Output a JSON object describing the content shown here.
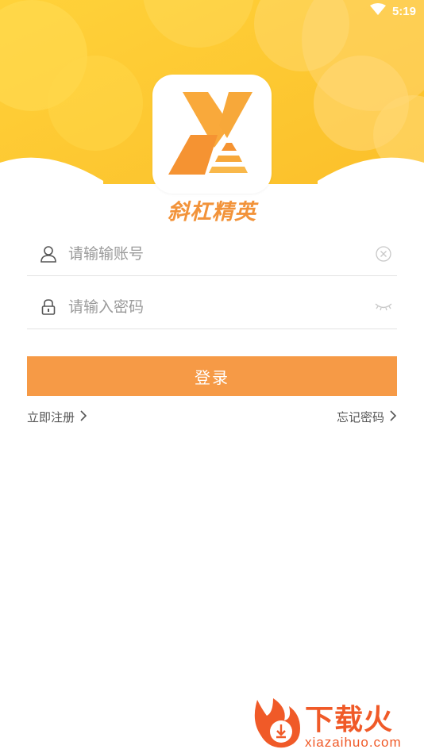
{
  "status_bar": {
    "time": "5:19",
    "wifi_icon": "wifi-icon"
  },
  "app": {
    "name": "斜杠精英",
    "logo_icon": "x-logo-icon"
  },
  "colors": {
    "accent": "#f69a46",
    "brand_text": "#f2933a",
    "header_yellow": "#fdc52a",
    "watermark": "#f05a28"
  },
  "form": {
    "account": {
      "placeholder": "请输输账号",
      "value": "",
      "lead_icon": "user-icon",
      "trail_icon": "clear-icon"
    },
    "password": {
      "placeholder": "请输入密码",
      "value": "",
      "lead_icon": "lock-icon",
      "trail_icon": "eye-closed-icon"
    },
    "login_label": "登录"
  },
  "links": {
    "register": "立即注册",
    "forgot": "忘记密码",
    "arrow_icon": "chevron-right-icon"
  },
  "watermark": {
    "title": "下载火",
    "subtitle": "xiazaihuo.com"
  }
}
